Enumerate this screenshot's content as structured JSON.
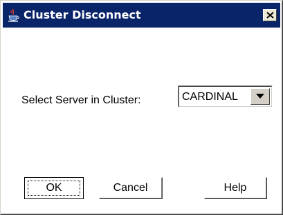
{
  "window": {
    "title": "Cluster Disconnect",
    "title_bar_color": "#0a246a",
    "app_icon": "java-cup-icon",
    "close_icon": "close-icon"
  },
  "form": {
    "server_label": "Select Server in Cluster:",
    "server_value": "CARDINAL",
    "dropdown_icon": "chevron-down-icon"
  },
  "buttons": {
    "ok_label": "OK",
    "cancel_label": "Cancel",
    "help_label": "Help"
  }
}
